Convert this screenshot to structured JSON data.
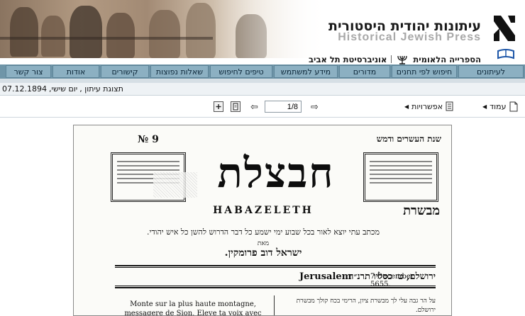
{
  "header": {
    "site_title_he": "עיתונות יהודית היסטורית",
    "site_title_en": "Historical Jewish Press",
    "library": "הספרייה הלאומית",
    "university": "אוניברסיטת תל אביב"
  },
  "nav": {
    "items": [
      {
        "label": "לעיתונים"
      },
      {
        "label": "חיפוש לפי תחנים"
      },
      {
        "label": "מדורים"
      },
      {
        "label": "מידע למשתמש"
      },
      {
        "label": "טיפים לחיפוש"
      },
      {
        "label": "שאלות נפוצות"
      },
      {
        "label": "קישורים"
      },
      {
        "label": "אודות"
      },
      {
        "label": "צור קשר"
      }
    ]
  },
  "issue": {
    "label": "תצוגת עיתון ,",
    "day": "יום שישי,",
    "date": "07.12.1894"
  },
  "toolbar": {
    "page_label": "עמוד",
    "options_label": "אפשרויות",
    "page_value": "1/8",
    "prev_icon": "arrow-left-icon",
    "next_icon": "arrow-right-icon"
  },
  "newspaper": {
    "issue_no": "№ 9",
    "year_line": "שנת העשרים ודמש",
    "masthead": "חבצלת",
    "latin_title": "HABAZELETH",
    "subtitle": "מבשרת",
    "motto": "מכתב עתי יוצא לאור בכל שבוע ימי ישמע כל דבר הדרוש להשן כל איש יהודי.",
    "by": "מאת",
    "editor": "ישראל דוב פרומקין.",
    "city_he": "ירושלם, ט׳ כסליו תרנ״ה.",
    "city_en": "Jerusalem",
    "date_en": "7 December 5655.",
    "col_fr": "Monte sur la plus haute montagne, messagere de Sion, Eleve ta voix avec force, envoyée de Jérusalem!",
    "col_he": "על הר גבה עלי לך מבשרת ציון, הרימי בכח קולך מבשרת ירושלם."
  }
}
